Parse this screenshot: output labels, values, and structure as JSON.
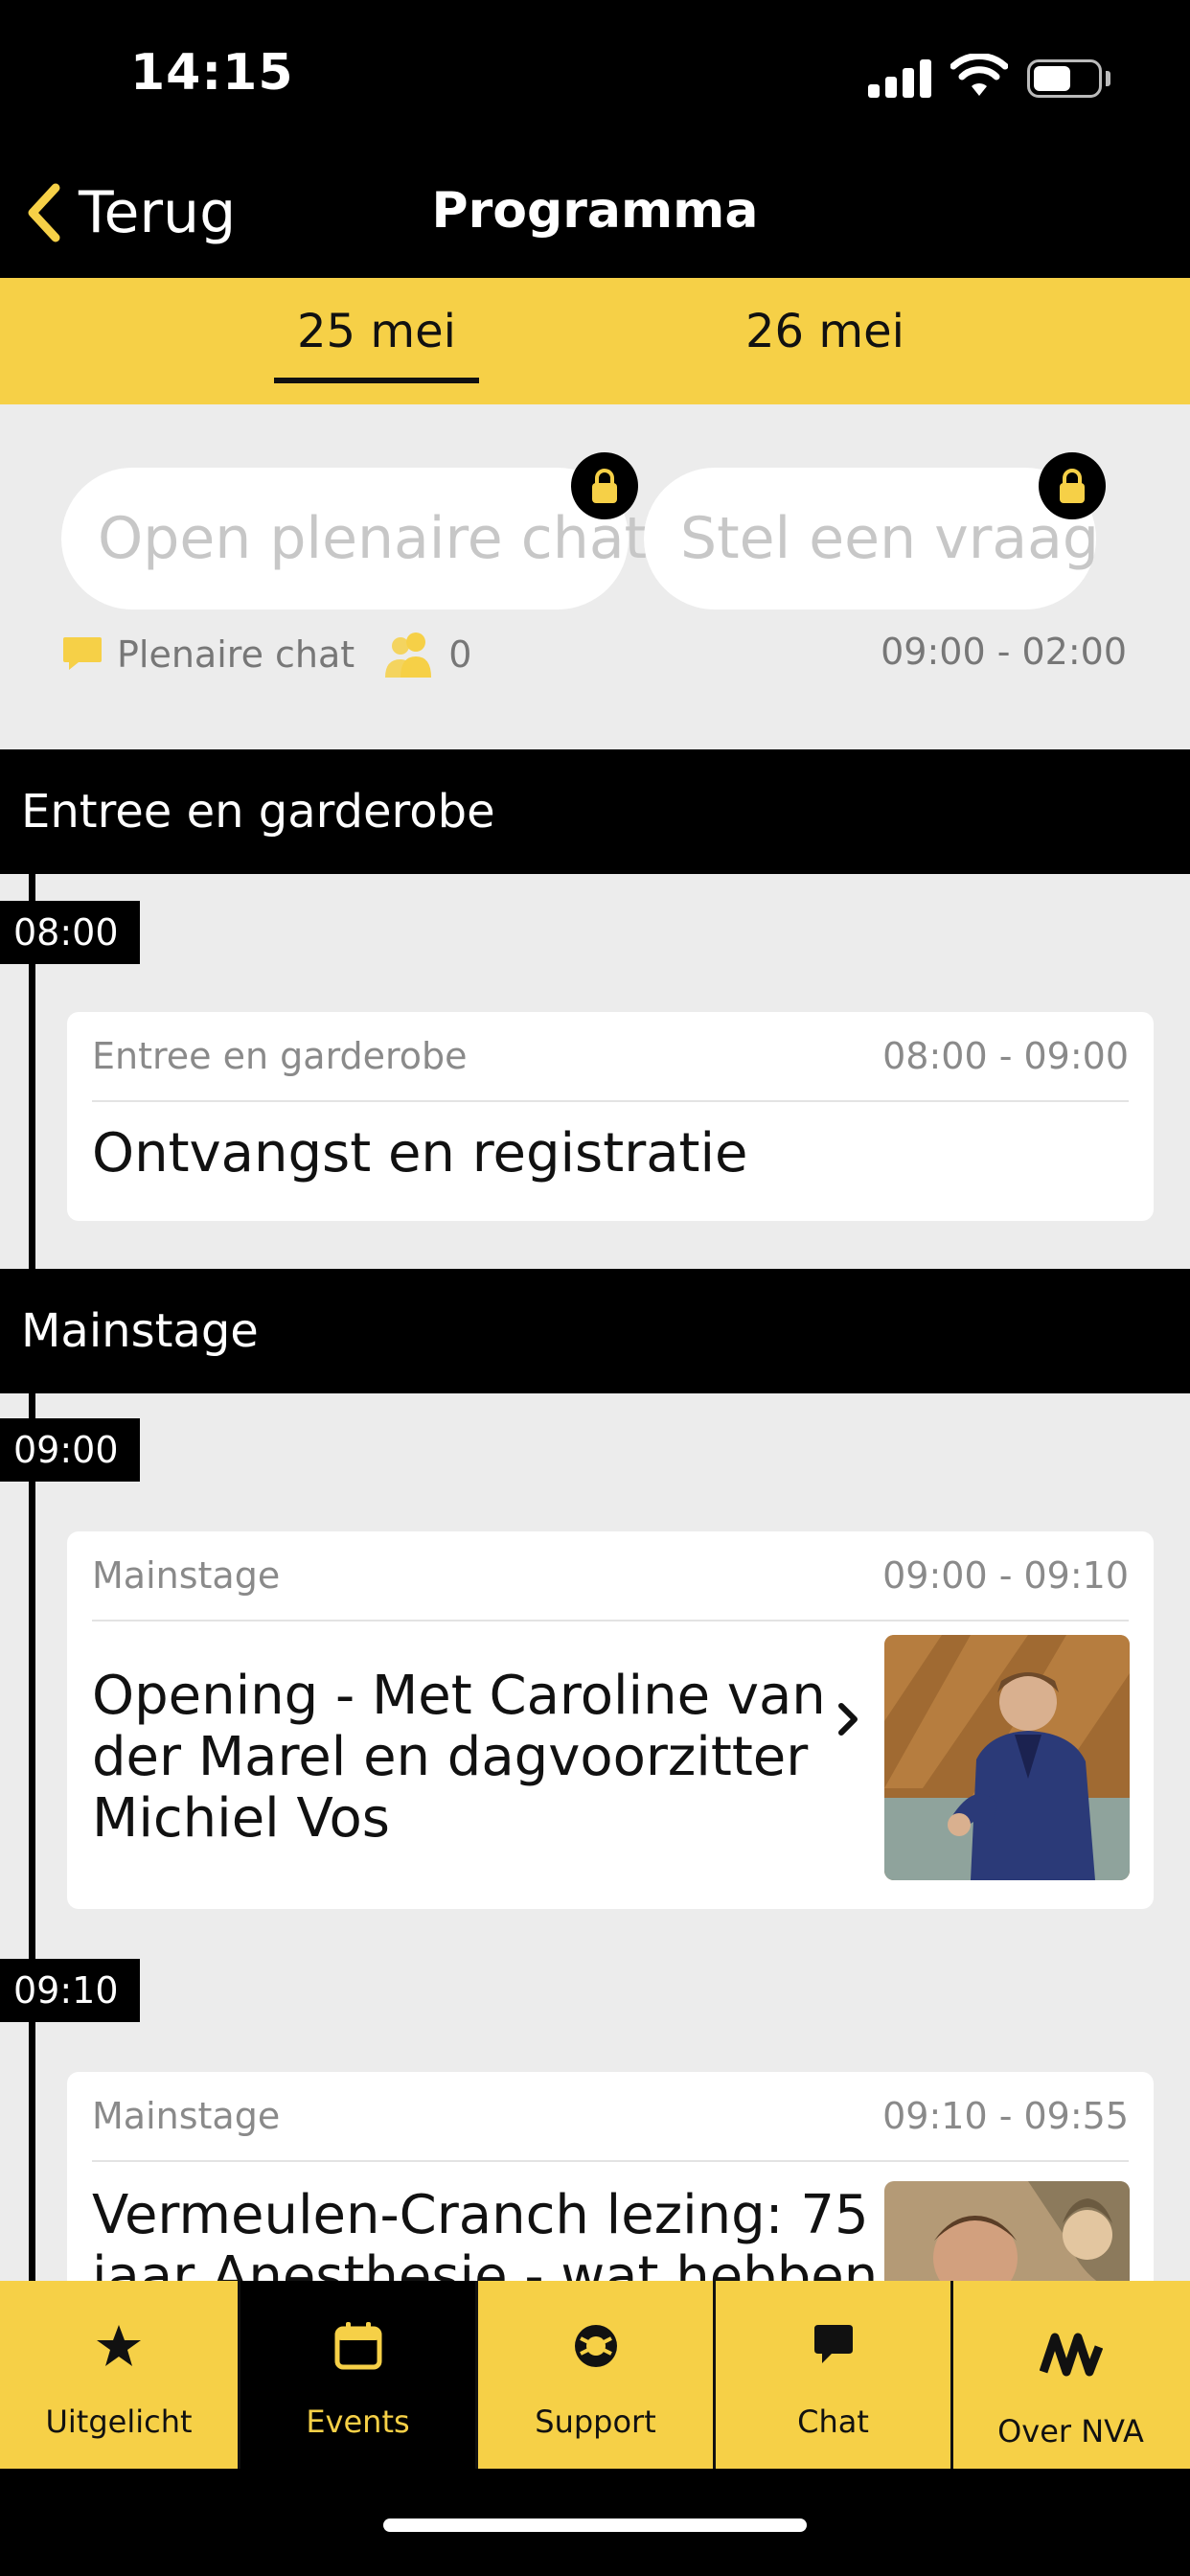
{
  "status_bar": {
    "time": "14:15"
  },
  "nav": {
    "back_label": "Terug",
    "title": "Programma"
  },
  "date_tabs": [
    {
      "label": "25 mei",
      "active": true
    },
    {
      "label": "26 mei",
      "active": false
    }
  ],
  "chat": {
    "open_chat_placeholder": "Open plenaire chat",
    "ask_question_placeholder": "Stel een vraag",
    "chat_label": "Plenaire chat",
    "participant_count": "0",
    "hours": "09:00 - 02:00"
  },
  "sections": [
    {
      "name": "Entree en garderobe",
      "time": "08:00",
      "session": {
        "location": "Entree en garderobe",
        "time_range": "08:00 - 09:00",
        "title": "Ontvangst en registratie"
      }
    },
    {
      "name": "Mainstage",
      "slots": [
        {
          "time": "09:00",
          "session": {
            "location": "Mainstage",
            "time_range": "09:00 - 09:10",
            "title_lines": [
              "Opening - Met Caroline van",
              "der Marel en dagvoorzitter",
              "Michiel Vos"
            ]
          }
        },
        {
          "time": "09:10",
          "session": {
            "location": "Mainstage",
            "time_range": "09:10 - 09:55",
            "title_lines": [
              "Vermeulen-Cranch lezing: 75",
              "jaar Anesthesie - wat hebben"
            ]
          }
        }
      ]
    }
  ],
  "tab_bar": [
    {
      "label": "Uitgelicht",
      "icon": "star-icon",
      "active": false
    },
    {
      "label": "Events",
      "icon": "calendar-icon",
      "active": true
    },
    {
      "label": "Support",
      "icon": "lifebuoy-icon",
      "active": false
    },
    {
      "label": "Chat",
      "icon": "chat-bubble-icon",
      "active": false
    },
    {
      "label": "Over NVA",
      "icon": "nva-logo-icon",
      "active": false
    }
  ],
  "colors": {
    "accent": "#f6d047",
    "dark": "#000000",
    "background": "#ececec"
  }
}
